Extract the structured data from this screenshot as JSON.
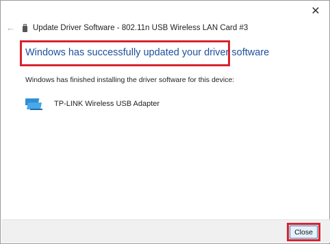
{
  "window": {
    "close_glyph": "✕",
    "back_glyph": "←",
    "title": "Update Driver Software - 802.11n USB Wireless LAN Card #3"
  },
  "content": {
    "headline": "Windows has successfully updated your driver software",
    "finished_text": "Windows has finished installing the driver software for this device:",
    "device_name": "TP-LINK Wireless USB Adapter"
  },
  "footer": {
    "close_label": "Close"
  },
  "colors": {
    "highlight": "#d9222e",
    "headline": "#1b4f9c",
    "button_border": "#3c7fb1"
  },
  "icons": {
    "usb_drive": "usb-drive-icon",
    "network_adapter": "network-adapter-icon"
  }
}
